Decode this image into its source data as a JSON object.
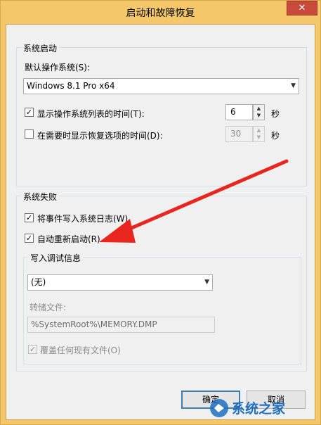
{
  "window": {
    "title": "启动和故障恢复",
    "close_glyph": "✕"
  },
  "startup": {
    "group_label": "系统启动",
    "default_os_label": "默认操作系统(S):",
    "default_os_value": "Windows 8.1 Pro x64",
    "show_list_label": "显示操作系统列表的时间(T):",
    "show_list_checked": true,
    "show_list_value": "6",
    "show_list_unit": "秒",
    "show_recovery_label": "在需要时显示恢复选项的时间(D):",
    "show_recovery_checked": false,
    "show_recovery_value": "30",
    "show_recovery_unit": "秒"
  },
  "failure": {
    "group_label": "系统失败",
    "write_event_label": "将事件写入系统日志(W)",
    "write_event_checked": true,
    "auto_restart_label": "自动重新启动(R)",
    "auto_restart_checked": true,
    "debug": {
      "group_label": "写入调试信息",
      "dump_type_value": "(无)",
      "dump_file_label": "转储文件:",
      "dump_file_value": "%SystemRoot%\\MEMORY.DMP",
      "overwrite_label": "覆盖任何现有文件(O)",
      "overwrite_checked": true
    }
  },
  "buttons": {
    "ok_label": "确定",
    "cancel_label": "取消"
  },
  "watermark": {
    "text": "系统之家"
  },
  "colors": {
    "titlebar": "#f4c86a",
    "close": "#c74a3a",
    "arrow": "#e8261f"
  }
}
